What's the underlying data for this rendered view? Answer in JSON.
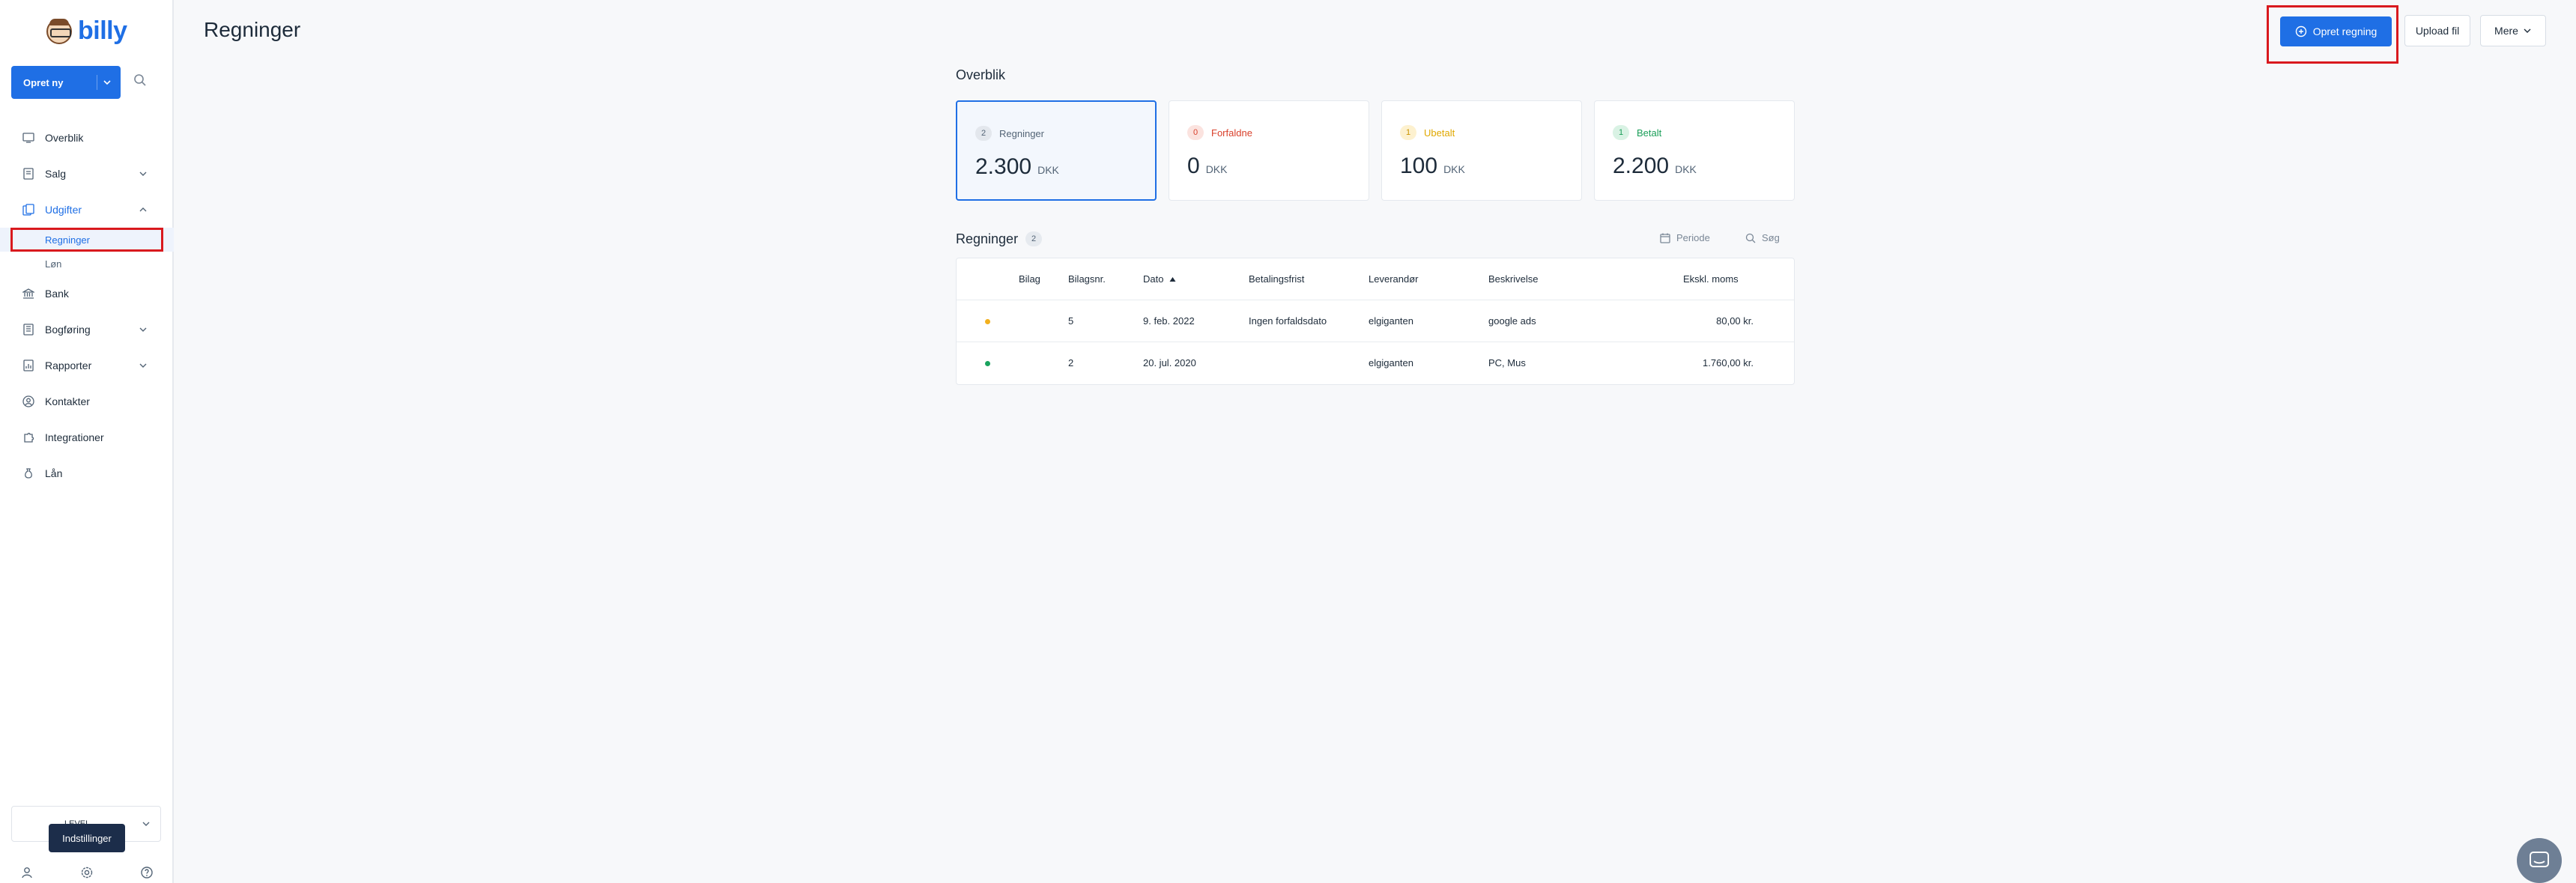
{
  "app": {
    "logo_text": "billy"
  },
  "sidebar": {
    "create_label": "Opret ny",
    "items": [
      {
        "label": "Overblik"
      },
      {
        "label": "Salg"
      },
      {
        "label": "Udgifter"
      },
      {
        "label": "Bank"
      },
      {
        "label": "Bogføring"
      },
      {
        "label": "Rapporter"
      },
      {
        "label": "Kontakter"
      },
      {
        "label": "Integrationer"
      },
      {
        "label": "Lån"
      }
    ],
    "subitems": [
      {
        "label": "Regninger"
      },
      {
        "label": "Løn"
      }
    ],
    "org_name": "LEVEL",
    "tooltip": "Indstillinger"
  },
  "header": {
    "title": "Regninger",
    "primary_button": "Opret regning",
    "upload_button": "Upload fil",
    "more_button": "Mere"
  },
  "overview": {
    "title": "Overblik",
    "cards": [
      {
        "count": "2",
        "label": "Regninger",
        "amount": "2.300",
        "currency": "DKK",
        "color": "#536476",
        "badge_bg": "#e3e7ed"
      },
      {
        "count": "0",
        "label": "Forfaldne",
        "amount": "0",
        "currency": "DKK",
        "color": "#d9402b",
        "badge_bg": "#fbe3df"
      },
      {
        "count": "1",
        "label": "Ubetalt",
        "amount": "100",
        "currency": "DKK",
        "color": "#e0a800",
        "badge_bg": "#fdf1cf"
      },
      {
        "count": "1",
        "label": "Betalt",
        "amount": "2.200",
        "currency": "DKK",
        "color": "#1a9e58",
        "badge_bg": "#d9f2e4"
      }
    ]
  },
  "bills": {
    "title": "Regninger",
    "count": "2",
    "period_label": "Periode",
    "search_label": "Søg",
    "columns": [
      "Bilag",
      "Bilagsnr.",
      "Dato",
      "Betalingsfrist",
      "Leverandør",
      "Beskrivelse",
      "Ekskl. moms"
    ],
    "rows": [
      {
        "status_color": "#f2b01e",
        "bilag": "",
        "bilagsnr": "5",
        "dato": "9. feb. 2022",
        "frist": "Ingen forfaldsdato",
        "leverandor": "elgiganten",
        "beskrivelse": "google ads",
        "belob": "80,00 kr."
      },
      {
        "status_color": "#1aa35e",
        "bilag": "",
        "bilagsnr": "2",
        "dato": "20. jul. 2020",
        "frist": "",
        "leverandor": "elgiganten",
        "beskrivelse": "PC, Mus",
        "belob": "1.760,00 kr."
      }
    ]
  }
}
